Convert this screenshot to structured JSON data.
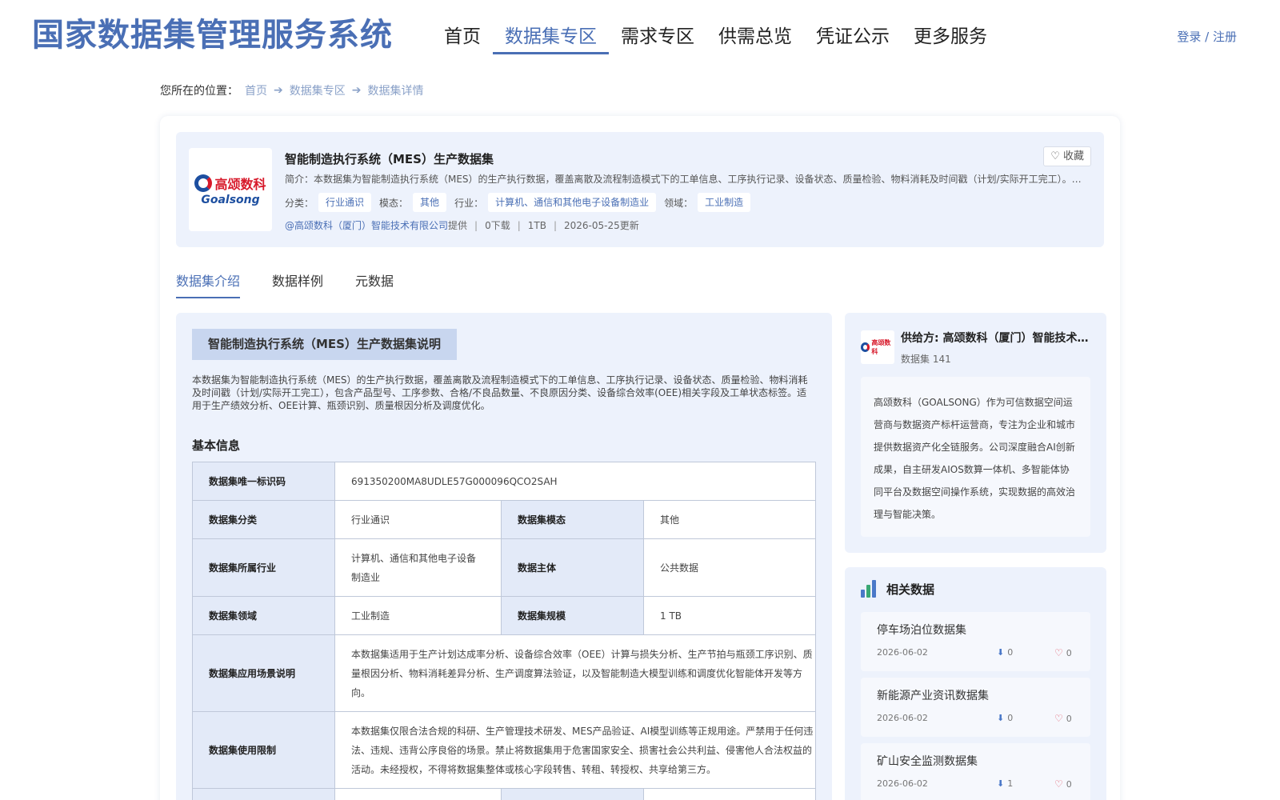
{
  "header": {
    "logo": "国家数据集管理服务系统",
    "nav": [
      {
        "label": "首页"
      },
      {
        "label": "数据集专区"
      },
      {
        "label": "需求专区"
      },
      {
        "label": "供需总览"
      },
      {
        "label": "凭证公示"
      },
      {
        "label": "更多服务"
      }
    ],
    "active_nav": "数据集专区",
    "login": "登录 / 注册"
  },
  "breadcrumb": {
    "prefix": "您所在的位置：",
    "items": [
      "首页",
      "数据集专区",
      "数据集详情"
    ]
  },
  "dataset": {
    "logo_cn": "高颂数科",
    "logo_en": "Goalsong",
    "title": "智能制造执行系统（MES）生产数据集",
    "favorite": "收藏",
    "intro": "简介：本数据集为智能制造执行系统（MES）的生产执行数据，覆盖离散及流程制造模式下的工单信息、工序执行记录、设备状态、质量检验、物料消耗及时间戳（计划/实际开工完工）。包含产品型号、工序参数、合格/不良品数量、不良原因分类、设备综合效率(OEE)相关字段及工单状态标签。",
    "tags": {
      "category_label": "分类：",
      "category": "行业通识",
      "modality_label": "模态：",
      "modality": "其他",
      "industry_label": "行业：",
      "industry": "计算机、通信和其他电子设备制造业",
      "domain_label": "领域：",
      "domain": "工业制造"
    },
    "meta": {
      "provider": "@高颂数科（厦门）智能技术有限公司",
      "provider_suffix": "提供",
      "downloads": "0下载",
      "size": "1TB",
      "updated": "2026-05-25更新"
    }
  },
  "tabs": [
    {
      "label": "数据集介绍"
    },
    {
      "label": "数据样例"
    },
    {
      "label": "元数据"
    }
  ],
  "description": {
    "title": "智能制造执行系统（MES）生产数据集说明",
    "text": "本数据集为智能制造执行系统（MES）的生产执行数据，覆盖离散及流程制造模式下的工单信息、工序执行记录、设备状态、质量检验、物料消耗及时间戳（计划/实际开工完工），包含产品型号、工序参数、合格/不良品数量、不良原因分类、设备综合效率(OEE)相关字段及工单状态标签。适用于生产绩效分析、OEE计算、瓶颈识别、质量根因分析及调度优化。"
  },
  "basic_info": {
    "title": "基本信息",
    "id_label": "数据集唯一标识码",
    "id_value": "691350200MA8UDLE57G000096QCO2SAH",
    "category_label": "数据集分类",
    "category_value": "行业通识",
    "modality_label": "数据集模态",
    "modality_value": "其他",
    "industry_label": "数据集所属行业",
    "industry_value": "计算机、通信和其他电子设备制造业",
    "subject_label": "数据主体",
    "subject_value": "公共数据",
    "domain_label": "数据集领域",
    "domain_value": "工业制造",
    "scale_label": "数据集规模",
    "scale_value": "1 TB",
    "scenario_label": "数据集应用场景说明",
    "scenario_value": "本数据集适用于生产计划达成率分析、设备综合效率（OEE）计算与损失分析、生产节拍与瓶颈工序识别、质量根因分析、物料消耗差异分析、生产调度算法验证，以及智能制造大模型训练和调度优化智能体开发等方向。",
    "limit_label": "数据集使用限制",
    "limit_value": "本数据集仅限合法合规的科研、生产管理技术研发、MES产品验证、AI模型训练等正规用途。严禁用于任何违法、违规、违背公序良俗的场景。禁止将数据集用于危害国家安全、损害社会公共利益、侵害他人合法权益的活动。未经授权，不得将数据集整体或核心字段转售、转租、转授权、共享给第三方。"
  },
  "supplier": {
    "name": "供给方: 高颂数科（厦门）智能技术有限公司",
    "count": "数据集 141",
    "desc": "高颂数科（GOALSONG）作为可信数据空间运营商与数据资产标杆运营商，专注为企业和城市提供数据资产化全链服务。公司深度融合AI创新成果，自主研发AIOS数算一体机、多智能体协同平台及数据空间操作系统，实现数据的高效治理与智能决策。"
  },
  "related": {
    "title": "相关数据",
    "items": [
      {
        "title": "停车场泊位数据集",
        "date": "2026-06-02",
        "downloads": "0",
        "likes": "0"
      },
      {
        "title": "新能源产业资讯数据集",
        "date": "2026-06-02",
        "downloads": "0",
        "likes": "0"
      },
      {
        "title": "矿山安全监测数据集",
        "date": "2026-06-02",
        "downloads": "1",
        "likes": "0"
      }
    ]
  }
}
